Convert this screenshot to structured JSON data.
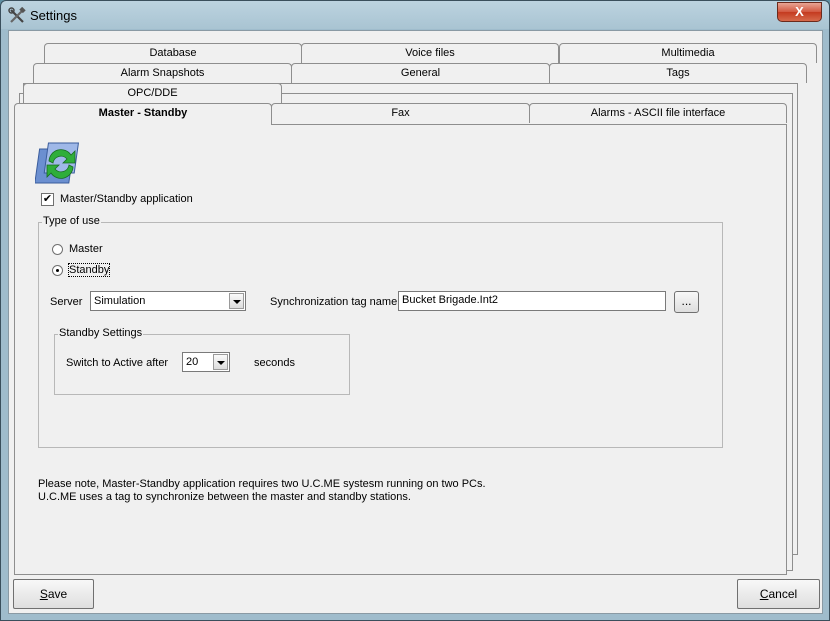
{
  "window": {
    "title": "Settings",
    "close_glyph": "X"
  },
  "tabs": {
    "row1": [
      "Database",
      "Voice files",
      "Multimedia"
    ],
    "row2": [
      "Alarm Snapshots",
      "General",
      "Tags"
    ],
    "row3": [
      "OPC/DDE"
    ],
    "row4": [
      "Master - Standby",
      "Fax",
      "Alarms - ASCII file interface"
    ],
    "active": "Master - Standby"
  },
  "master_standby": {
    "icon": "sync-arrows-icon",
    "app_checkbox": {
      "label": "Master/Standby application",
      "checked": true
    },
    "type_group": {
      "caption": "Type of use",
      "options": [
        "Master",
        "Standby"
      ],
      "selected": "Standby",
      "server_label": "Server",
      "server_value": "Simulation",
      "sync_label": "Synchronization tag name",
      "sync_value": "Bucket Brigade.Int2",
      "browse_label": "...",
      "standby_group": {
        "caption": "Standby Settings",
        "switch_label": "Switch to Active after",
        "switch_value": "20",
        "unit": "seconds"
      }
    },
    "notes": [
      "Please note, Master-Standby application requires two U.C.ME systesm running on two PCs.",
      "U.C.ME uses a tag to synchronize between the master and standby stations."
    ]
  },
  "footer": {
    "save_label": "Save",
    "cancel_label": "Cancel"
  }
}
